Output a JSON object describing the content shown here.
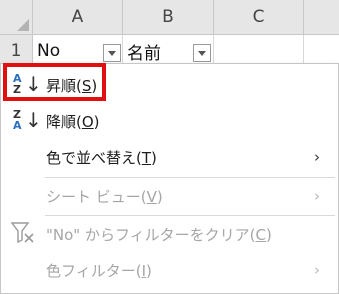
{
  "sheet": {
    "columns": [
      "A",
      "B",
      "C"
    ],
    "row_number": "1",
    "cells": {
      "A1": "No",
      "B1": "名前"
    }
  },
  "menu": {
    "items": [
      {
        "id": "sort-asc",
        "label": "昇順(S)",
        "text": "昇順(",
        "key": "S",
        "tail": ")",
        "enabled": true,
        "icon": "sort-a-to-z-icon"
      },
      {
        "id": "sort-desc",
        "label": "降順(O)",
        "text": "降順(",
        "key": "O",
        "tail": ")",
        "enabled": true,
        "icon": "sort-z-to-a-icon"
      },
      {
        "id": "sort-by-color",
        "label": "色で並べ替え(T)",
        "text": "色で並べ替え(",
        "key": "T",
        "tail": ")",
        "enabled": true,
        "submenu": true
      },
      {
        "id": "sheet-view",
        "label": "シート ビュー(V)",
        "text": "シート ビュー(",
        "key": "V",
        "tail": ")",
        "enabled": false,
        "submenu": true
      },
      {
        "id": "clear-filter",
        "label": "\"No\" からフィルターをクリア(C)",
        "text": "\"No\" からフィルターをクリア(",
        "key": "C",
        "tail": ")",
        "enabled": false,
        "icon": "clear-filter-icon"
      },
      {
        "id": "color-filter",
        "label": "色フィルター(I)",
        "text": "色フィルター(",
        "key": "I",
        "tail": ")",
        "enabled": false,
        "submenu": true
      }
    ],
    "icon_letters": {
      "a": "A",
      "z": "Z",
      "down": "↓"
    },
    "submenu_arrow": "›"
  },
  "colors": {
    "highlight": "#e01010",
    "accent_blue": "#2b6fc1",
    "disabled_text": "#a6a6a6"
  }
}
